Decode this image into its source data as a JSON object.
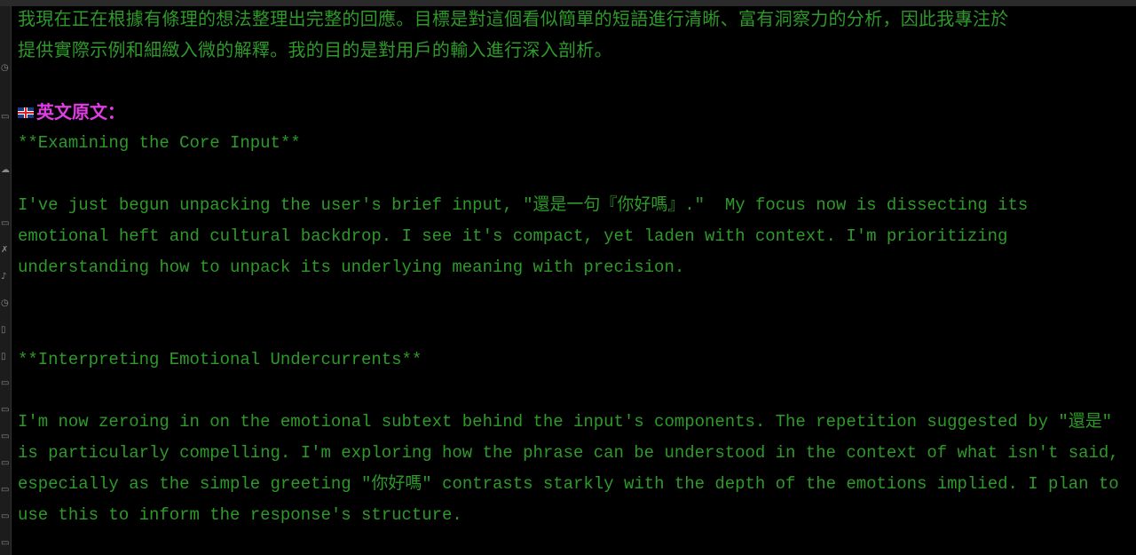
{
  "summary_zh": [
    "我現在正在根據有條理的想法整理出完整的回應。目標是對這個看似簡單的短語進行清晰、富有洞察力的分析，因此我專注於",
    "提供實際示例和細緻入微的解釋。我的目的是對用戶的輸入進行深入剖析。"
  ],
  "section_heading": {
    "icon": "uk-flag-icon",
    "label": "英文原文："
  },
  "original": {
    "title1": "**Examining the Core Input**",
    "para1": [
      "I've just begun unpacking the user's brief input, \"還是一句『你好嗎』.\"  My focus now is dissecting its",
      "emotional heft and cultural backdrop. I see it's compact, yet laden with context. I'm prioritizing",
      "understanding how to unpack its underlying meaning with precision."
    ],
    "title2": "**Interpreting Emotional Undercurrents**",
    "para2": [
      "I'm now zeroing in on the emotional subtext behind the input's components. The repetition suggested by \"還是\"",
      "is particularly compelling. I'm exploring how the phrase can be understood in the context of what isn't said,",
      "especially as the simple greeting \"你好嗎\" contrasts starkly with the depth of the emotions implied. I plan to",
      "use this to inform the response's structure."
    ]
  },
  "colors": {
    "text": "#2e9a2a",
    "heading": "#e23ee6",
    "background": "#000000"
  }
}
